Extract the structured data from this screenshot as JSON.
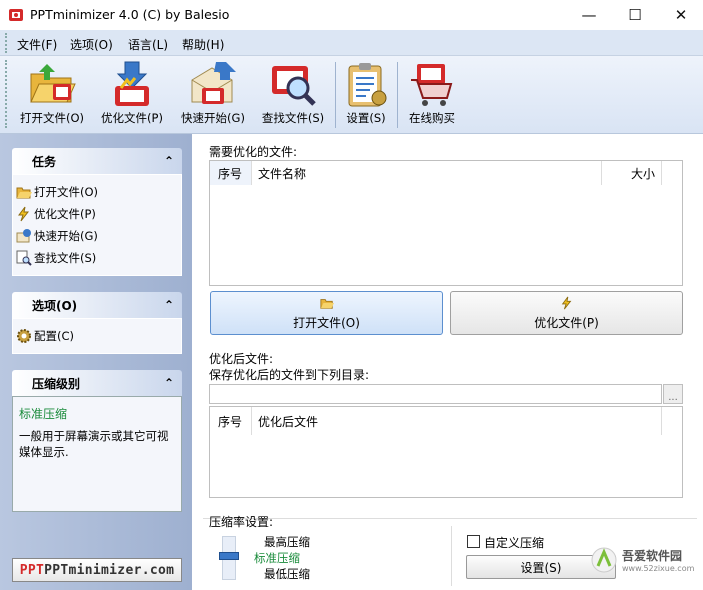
{
  "window": {
    "title": "PPTminimizer 4.0 (C) by Balesio",
    "minimize": "—",
    "maximize": "☐",
    "close": "✕"
  },
  "menu": [
    "文件(F)",
    "选项(O)",
    "语言(L)",
    "帮助(H)"
  ],
  "toolbar": [
    {
      "label": "打开文件(O)",
      "icon": "open-folder-icon"
    },
    {
      "label": "优化文件(P)",
      "icon": "optimize-icon"
    },
    {
      "label": "快速开始(G)",
      "icon": "quick-start-icon"
    },
    {
      "label": "查找文件(S)",
      "icon": "find-file-icon"
    },
    {
      "label": "设置(S)",
      "icon": "settings-clipboard-icon"
    },
    {
      "label": "在线购买",
      "icon": "shopping-cart-icon"
    }
  ],
  "tasks": {
    "title": "任务",
    "items": [
      "打开文件(O)",
      "优化文件(P)",
      "快速开始(G)",
      "查找文件(S)"
    ]
  },
  "options": {
    "title": "选项(O)",
    "items": [
      "配置(C)"
    ]
  },
  "compression_level": {
    "title": "压缩级别",
    "name": "标准压缩",
    "desc": "一般用于屏幕演示或其它可视媒体显示."
  },
  "logo_text": "PPTminimizer.com",
  "files_to_optimize": {
    "label": "需要优化的文件:",
    "columns": {
      "index": "序号",
      "name": "文件名称",
      "size": "大小"
    },
    "rows": []
  },
  "buttons": {
    "open": "打开文件(O)",
    "optimize": "优化文件(P)"
  },
  "output": {
    "label": "优化后文件:",
    "save_to": "保存优化后的文件到下列目录:",
    "path_value": "",
    "browse": "...",
    "columns": {
      "index": "序号",
      "name": "优化后文件"
    },
    "rows": []
  },
  "compression_settings": {
    "label": "压缩率设置:",
    "levels": [
      "最高压缩",
      "标准压缩",
      "最低压缩"
    ],
    "selected": "标准压缩",
    "custom_label": "自定义压缩",
    "custom_checked": false,
    "settings_button": "设置(S)"
  },
  "watermark": {
    "brand": "吾爱软件园",
    "url": "www.52zixue.com"
  },
  "colors": {
    "accent_blue": "#3a78c8",
    "selected_green": "#1b8c3c",
    "panel_bg": "#dce6f4"
  }
}
